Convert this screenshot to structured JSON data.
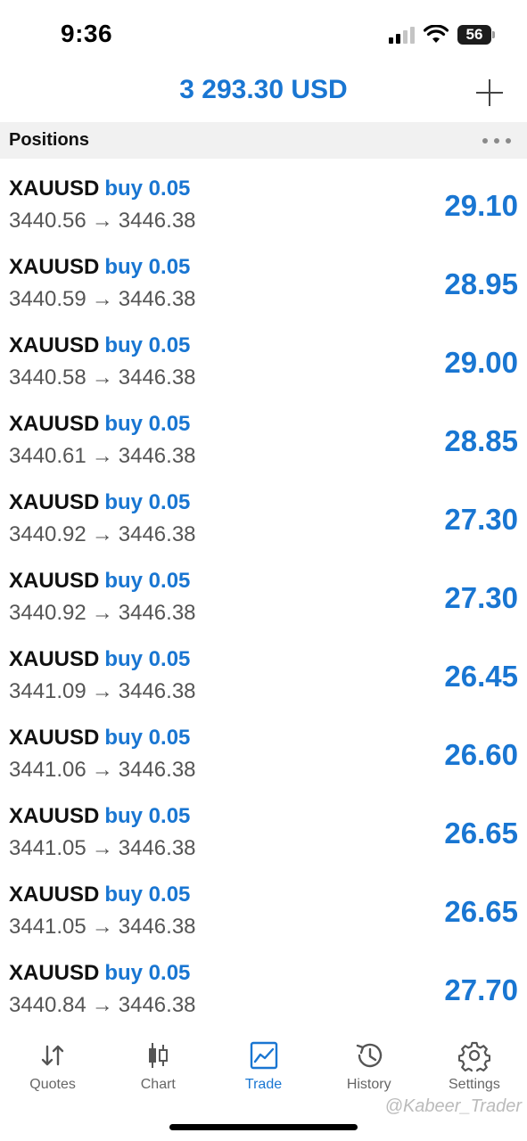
{
  "status_bar": {
    "time": "9:36",
    "battery": "56"
  },
  "header": {
    "balance": "3 293.30 USD"
  },
  "section": {
    "title": "Positions"
  },
  "positions": [
    {
      "symbol": "XAUUSD",
      "side": "buy 0.05",
      "open": "3440.56",
      "arrow": "→",
      "current": "3446.38",
      "profit": "29.10"
    },
    {
      "symbol": "XAUUSD",
      "side": "buy 0.05",
      "open": "3440.59",
      "arrow": "→",
      "current": "3446.38",
      "profit": "28.95"
    },
    {
      "symbol": "XAUUSD",
      "side": "buy 0.05",
      "open": "3440.58",
      "arrow": "→",
      "current": "3446.38",
      "profit": "29.00"
    },
    {
      "symbol": "XAUUSD",
      "side": "buy 0.05",
      "open": "3440.61",
      "arrow": "→",
      "current": "3446.38",
      "profit": "28.85"
    },
    {
      "symbol": "XAUUSD",
      "side": "buy 0.05",
      "open": "3440.92",
      "arrow": "→",
      "current": "3446.38",
      "profit": "27.30"
    },
    {
      "symbol": "XAUUSD",
      "side": "buy 0.05",
      "open": "3440.92",
      "arrow": "→",
      "current": "3446.38",
      "profit": "27.30"
    },
    {
      "symbol": "XAUUSD",
      "side": "buy 0.05",
      "open": "3441.09",
      "arrow": "→",
      "current": "3446.38",
      "profit": "26.45"
    },
    {
      "symbol": "XAUUSD",
      "side": "buy 0.05",
      "open": "3441.06",
      "arrow": "→",
      "current": "3446.38",
      "profit": "26.60"
    },
    {
      "symbol": "XAUUSD",
      "side": "buy 0.05",
      "open": "3441.05",
      "arrow": "→",
      "current": "3446.38",
      "profit": "26.65"
    },
    {
      "symbol": "XAUUSD",
      "side": "buy 0.05",
      "open": "3441.05",
      "arrow": "→",
      "current": "3446.38",
      "profit": "26.65"
    },
    {
      "symbol": "XAUUSD",
      "side": "buy 0.05",
      "open": "3440.84",
      "arrow": "→",
      "current": "3446.38",
      "profit": "27.70"
    }
  ],
  "tabs": [
    {
      "label": "Quotes",
      "icon": "quotes-arrows-icon",
      "active": false
    },
    {
      "label": "Chart",
      "icon": "candlestick-icon",
      "active": false
    },
    {
      "label": "Trade",
      "icon": "trade-chart-icon",
      "active": true
    },
    {
      "label": "History",
      "icon": "history-clock-icon",
      "active": false
    },
    {
      "label": "Settings",
      "icon": "gear-icon",
      "active": false
    }
  ],
  "watermark": "@Kabeer_Trader",
  "colors": {
    "accent": "#1976d2",
    "section_bg": "#f1f1f1",
    "secondary_text": "#555555"
  }
}
